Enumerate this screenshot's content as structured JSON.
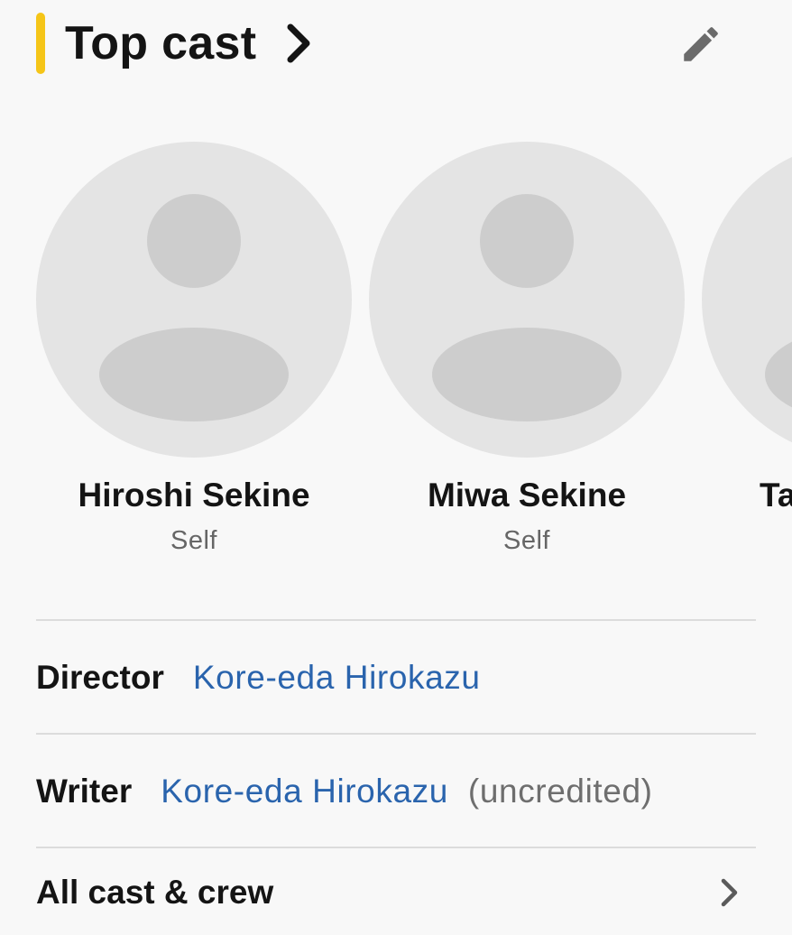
{
  "colors": {
    "accent": "#f5c518",
    "link": "#2a64ad",
    "avatar_bg": "#e4e4e4",
    "avatar_figure": "#cdcdcd"
  },
  "header": {
    "title": "Top cast",
    "chevron_icon": "chevron-right-icon",
    "edit_icon": "pencil-icon"
  },
  "cast": [
    {
      "name": "Hiroshi Sekine",
      "role": "Self",
      "avatar_icon": "person-placeholder-icon"
    },
    {
      "name": "Miwa Sekine",
      "role": "Self",
      "avatar_icon": "person-placeholder-icon"
    },
    {
      "name": "Ta",
      "role": "",
      "avatar_icon": "person-placeholder-icon"
    }
  ],
  "credits": {
    "director": {
      "label": "Director",
      "value": "Kore-eda Hirokazu"
    },
    "writer": {
      "label": "Writer",
      "value": "Kore-eda Hirokazu",
      "note": "(uncredited)"
    }
  },
  "all_cast": {
    "label": "All cast & crew",
    "chevron_icon": "chevron-right-icon"
  }
}
